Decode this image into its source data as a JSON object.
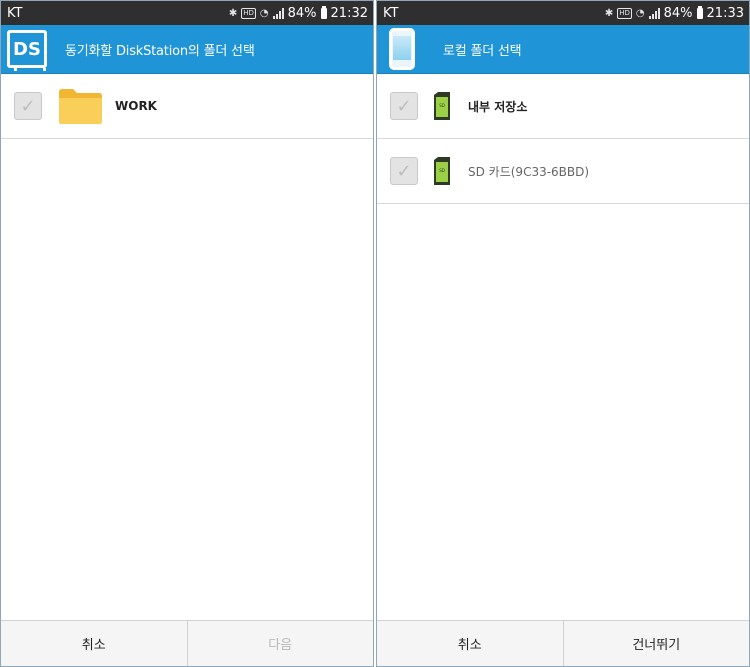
{
  "left_screen": {
    "status": {
      "carrier": "KT",
      "battery": "84%",
      "time": "21:32",
      "network_badge": "HD"
    },
    "header": {
      "title": "동기화할 DiskStation의 폴더 선택",
      "icon": "ds-logo",
      "logo_text": "DS"
    },
    "items": [
      {
        "label": "WORK",
        "icon": "folder-icon",
        "checked": false
      }
    ],
    "buttons": {
      "cancel": "취소",
      "next": "다음"
    }
  },
  "right_screen": {
    "status": {
      "carrier": "KT",
      "battery": "84%",
      "time": "21:33",
      "network_badge": "HD"
    },
    "header": {
      "title": "로컬 폴더 선택",
      "icon": "phone-icon"
    },
    "items": [
      {
        "label": "내부 저장소",
        "icon": "sd-card-icon",
        "checked": false
      },
      {
        "label": "SD 카드(9C33-6BBD)",
        "icon": "sd-card-icon",
        "checked": false
      }
    ],
    "buttons": {
      "cancel": "취소",
      "skip": "건너뛰기"
    }
  },
  "colors": {
    "header": "#1f94d6",
    "statusbar": "#2f2f2f",
    "folder": "#f7c342",
    "sd_card": "#9bd046"
  }
}
